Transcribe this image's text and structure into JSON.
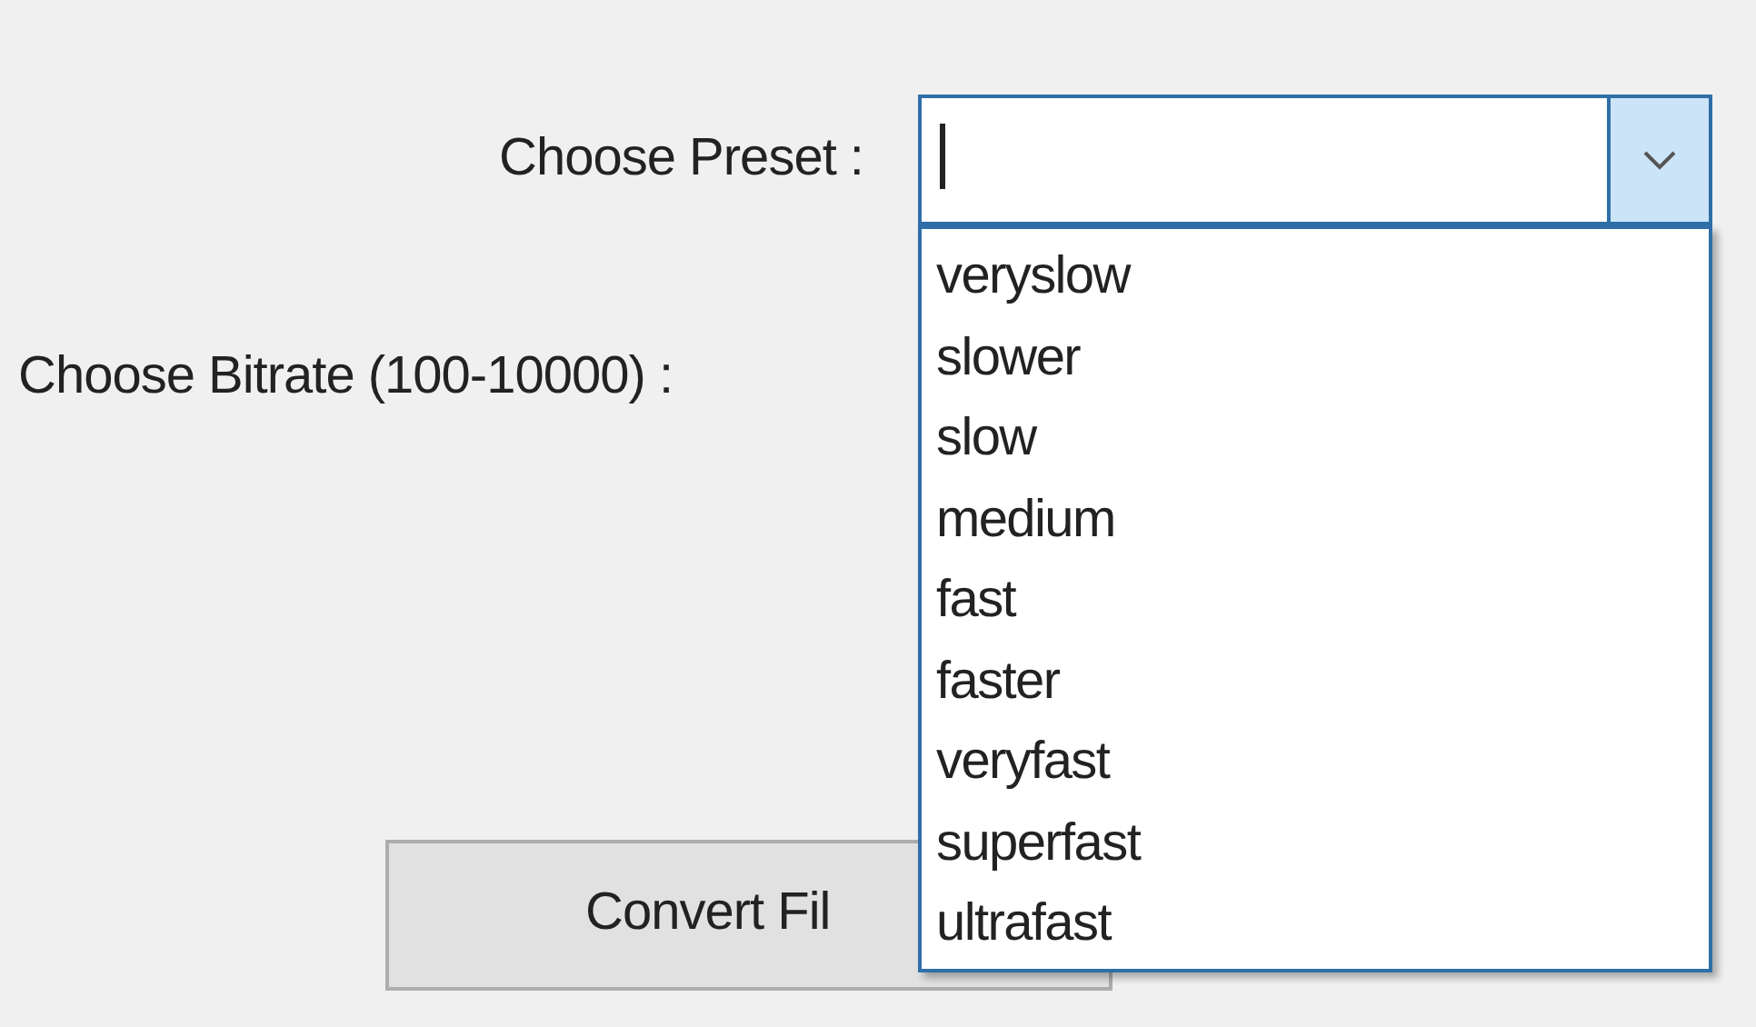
{
  "preset": {
    "label": "Choose Preset :",
    "expanded": true,
    "options": [
      {
        "label": "veryslow",
        "selected": false
      },
      {
        "label": "slower",
        "selected": false
      },
      {
        "label": "slow",
        "selected": false
      },
      {
        "label": "medium",
        "selected": false
      },
      {
        "label": "fast",
        "selected": false
      },
      {
        "label": "faster",
        "selected": false
      },
      {
        "label": "veryfast",
        "selected": false
      },
      {
        "label": "superfast",
        "selected": false
      },
      {
        "label": "ultrafast",
        "selected": false
      }
    ]
  },
  "bitrate": {
    "label": "Choose Bitrate (100-10000) :"
  },
  "convert_button": {
    "label": "Convert Fil"
  }
}
